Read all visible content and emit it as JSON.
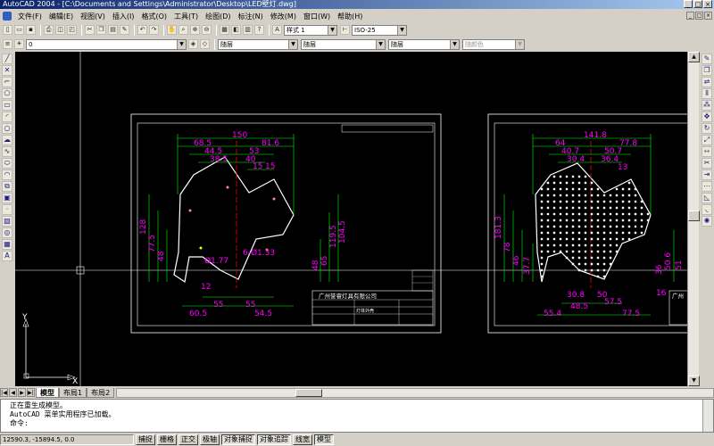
{
  "window": {
    "title": "AutoCAD 2004 - [C:\\Documents and Settings\\Administrator\\Desktop\\LED壁灯.dwg]"
  },
  "menu": {
    "items": [
      "文件(F)",
      "编辑(E)",
      "视图(V)",
      "插入(I)",
      "格式(O)",
      "工具(T)",
      "绘图(D)",
      "标注(N)",
      "修改(M)",
      "窗口(W)",
      "帮助(H)"
    ]
  },
  "toolbar": {
    "text_style": "样式 1",
    "dim_style": "ISO-25",
    "layer": "0",
    "color": "随层",
    "linetype": "随层",
    "lineweight": "随层",
    "plotstyle": "随颜色"
  },
  "drawing": {
    "left": {
      "dims_top": [
        "150",
        "68.5",
        "81.6",
        "44.5",
        "53",
        "38.5",
        "40",
        "15",
        "15"
      ],
      "dims_left": [
        "128",
        "77.5",
        "48"
      ],
      "dims_right": [
        "104.5",
        "119.5",
        "65",
        "48"
      ],
      "dims_bottom": [
        "60.5",
        "55",
        "55",
        "54.5",
        "12"
      ],
      "dims_inner": [
        "6-Ø1.33",
        "Ø1.77"
      ],
      "company": "广州誉睿灯具有限公司",
      "product": "灯体外壳"
    },
    "right": {
      "dims_top": [
        "141.8",
        "64",
        "77.8",
        "40.7",
        "50.7",
        "30.4",
        "36.4",
        "13"
      ],
      "dims_left": [
        "181.3",
        "78",
        "46",
        "37.7"
      ],
      "dims_right": [
        "50.6",
        "36",
        "51",
        "16"
      ],
      "dims_bottom": [
        "55.4",
        "48.5",
        "57.5",
        "30.8",
        "50",
        "77.5"
      ],
      "company_partial": "广州"
    },
    "ucs": {
      "x_label": "X",
      "y_label": "Y"
    }
  },
  "tabs": {
    "items": [
      "模型",
      "布局1",
      "布局2"
    ],
    "active": 0
  },
  "command": {
    "lines": [
      "正在重生成模型。",
      "AutoCAD 菜单实用程序已加载。",
      "命令:"
    ]
  },
  "status": {
    "coords": "12590.3, -15894.5, 0.0",
    "buttons": [
      "捕捉",
      "栅格",
      "正交",
      "极轴",
      "对象捕捉",
      "对象追踪",
      "线宽",
      "模型"
    ],
    "on": [
      false,
      false,
      false,
      false,
      true,
      true,
      false,
      true
    ]
  },
  "colors": {
    "dim": "#00ff00",
    "text": "#ff00ff",
    "outline": "#ffffff",
    "center": "#ff0000"
  }
}
